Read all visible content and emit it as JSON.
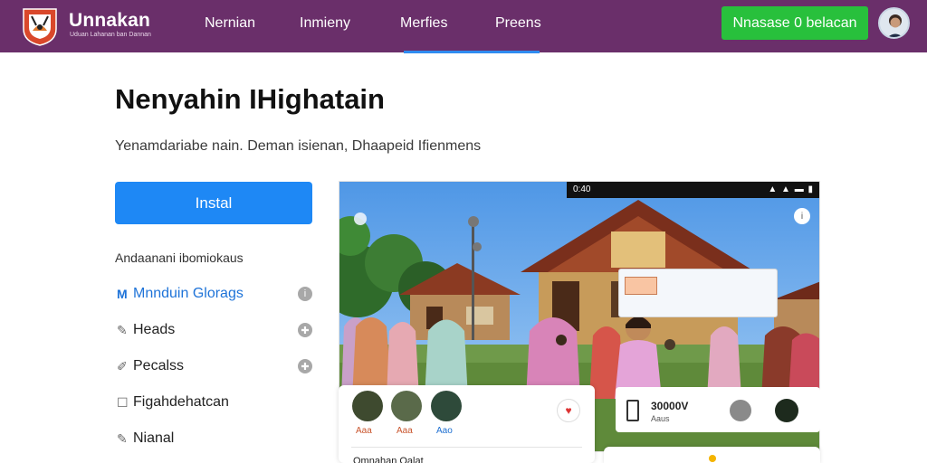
{
  "header": {
    "brand_name": "Unnakan",
    "brand_tagline": "Uduan Lahanan ban Dannan",
    "nav": [
      {
        "label": "Nernian"
      },
      {
        "label": "Inmieny"
      },
      {
        "label": "Merfies"
      },
      {
        "label": "Preens"
      }
    ],
    "active_nav": "Merfies",
    "cta_label": "Nnasase 0 belacan"
  },
  "main": {
    "title": "Nenyahin IHighatain",
    "subtitle": "Yenamdariabe nain. Deman isienan, Dhaapeid Ifienmens",
    "install_label": "Instal",
    "section_label": "Andaanani ibomiokaus",
    "sidebar": [
      {
        "icon": "m-icon",
        "glyph": "M",
        "label": "Mnnduin Glorags",
        "active": true,
        "tail": "i"
      },
      {
        "icon": "pencil-icon",
        "glyph": "✎",
        "label": "Heads",
        "active": false,
        "tail": "✚"
      },
      {
        "icon": "pen-icon",
        "glyph": "✐",
        "label": "Pecalss",
        "active": false,
        "tail": "✚"
      },
      {
        "icon": "box-icon",
        "glyph": "☐",
        "label": "Figahdehatcan",
        "active": false,
        "tail": ""
      },
      {
        "icon": "edit-icon",
        "glyph": "✎",
        "label": "Nianal",
        "active": false,
        "tail": ""
      }
    ]
  },
  "preview": {
    "status_time": "0:40",
    "status_icons": "▲ ▲ ▬ ▮",
    "info_icon": "i",
    "users": [
      {
        "label": "Aaa"
      },
      {
        "label": "Aaa"
      },
      {
        "label": "Aao"
      }
    ],
    "heart_icon": "♥",
    "card_footer": "Omnahan Oalat",
    "stats_value": "30000V",
    "stats_sub": "Aaus"
  },
  "colors": {
    "header_bg": "#6a2f6a",
    "cta": "#28c03c",
    "primary": "#1e88f5",
    "active_link": "#1e73d8"
  }
}
